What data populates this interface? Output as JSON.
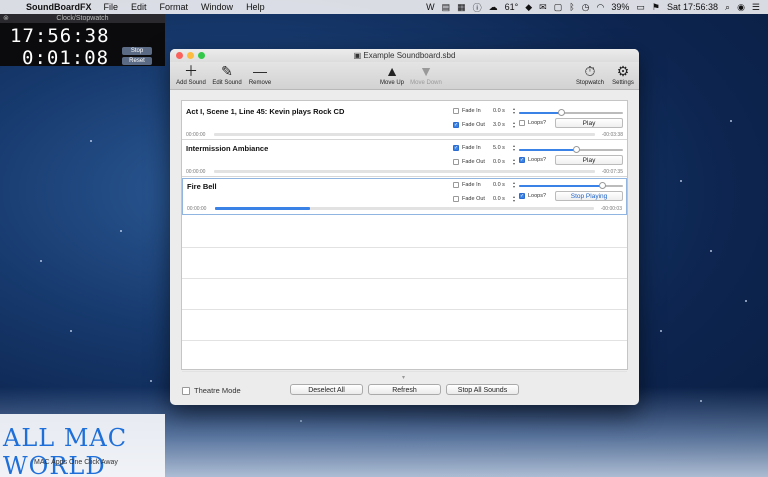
{
  "menubar": {
    "app_name": "SoundBoardFX",
    "items": [
      "File",
      "Edit",
      "Format",
      "Window",
      "Help"
    ],
    "temperature": "61°",
    "battery": "39%",
    "clock": "Sat 17:56:38"
  },
  "clock_widget": {
    "title": "Clock/Stopwatch",
    "time": "17:56:38",
    "stopwatch": "0:01:08",
    "stop_label": "Stop",
    "reset_label": "Reset"
  },
  "window": {
    "title": "Example Soundboard.sbd",
    "toolbar": {
      "add_sound": "Add Sound",
      "edit_sound": "Edit Sound",
      "remove": "Remove",
      "move_up": "Move Up",
      "move_down": "Move Down",
      "stopwatch": "Stopwatch",
      "settings": "Settings"
    },
    "labels": {
      "fade_in": "Fade In",
      "fade_out": "Fade Out",
      "loops": "Loops?"
    },
    "sounds": [
      {
        "name": "Act I, Scene 1, Line 45: Kevin plays Rock CD",
        "fade_in_checked": false,
        "fade_in_value": "0.0 s",
        "fade_out_checked": true,
        "fade_out_value": "3.0 s",
        "loops_checked": false,
        "volume": 0.4,
        "button": "Play",
        "elapsed": "00:00:00",
        "remaining": "-00:03:38",
        "progress": 0.0
      },
      {
        "name": "Intermission Ambiance",
        "fade_in_checked": true,
        "fade_in_value": "5.0 s",
        "fade_out_checked": false,
        "fade_out_value": "0.0 s",
        "loops_checked": true,
        "volume": 0.55,
        "button": "Play",
        "elapsed": "00:00:00",
        "remaining": "-00:07:35",
        "progress": 0.0
      },
      {
        "name": "Fire Bell",
        "fade_in_checked": false,
        "fade_in_value": "0.0 s",
        "fade_out_checked": false,
        "fade_out_value": "0.0 s",
        "loops_checked": true,
        "volume": 0.8,
        "button": "Stop Playing",
        "elapsed": "00:00:00",
        "remaining": "-00:00:03",
        "progress": 0.25
      }
    ],
    "footer": {
      "theatre_mode": "Theatre Mode",
      "deselect_all": "Deselect All",
      "refresh": "Refresh",
      "stop_all": "Stop All Sounds"
    }
  },
  "watermark": {
    "logo": "ALL MAC WORLD",
    "tagline": "MAC Apps One Click Away"
  },
  "colors": {
    "accent": "#3b82e6",
    "close": "#fc605c",
    "minimize": "#fdbc40",
    "zoom": "#34c84a"
  }
}
